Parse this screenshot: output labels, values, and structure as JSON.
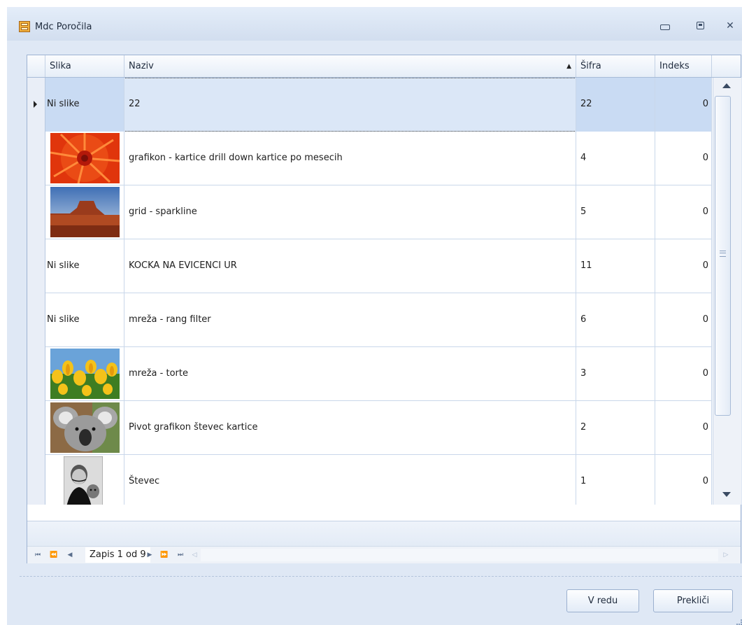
{
  "window": {
    "title": "Mdc Poročila"
  },
  "grid": {
    "columns": {
      "slika": "Slika",
      "naziv": "Naziv",
      "sifra": "Šifra",
      "indeks": "Indeks"
    },
    "rows": [
      {
        "slika": "Ni slike",
        "image": "",
        "naziv": "22",
        "sifra": "22",
        "indeks": "0",
        "selected": true
      },
      {
        "slika": "",
        "image": "red-flower-photo",
        "naziv": "grafikon - kartice drill down kartice po mesecih",
        "sifra": "4",
        "indeks": "0"
      },
      {
        "slika": "",
        "image": "desert-butte-photo",
        "naziv": "grid - sparkline",
        "sifra": "5",
        "indeks": "0"
      },
      {
        "slika": "Ni slike",
        "image": "",
        "naziv": "KOCKA NA EVICENCI UR",
        "sifra": "11",
        "indeks": "0"
      },
      {
        "slika": "Ni slike",
        "image": "",
        "naziv": "mreža - rang filter",
        "sifra": "6",
        "indeks": "0"
      },
      {
        "slika": "",
        "image": "yellow-tulips-photo",
        "naziv": "mreža - torte",
        "sifra": "3",
        "indeks": "0"
      },
      {
        "slika": "",
        "image": "koala-photo",
        "naziv": "Pivot grafikon števec kartice",
        "sifra": "2",
        "indeks": "0"
      },
      {
        "slika": "",
        "image": "man-with-cat-photo",
        "naziv": "Števec",
        "sifra": "1",
        "indeks": "0"
      }
    ]
  },
  "navigator": {
    "record_info": "Zapis 1 od 9"
  },
  "buttons": {
    "ok": "V redu",
    "cancel": "Prekliči"
  },
  "colors": {
    "selection": "#c9dbf3",
    "window_bg": "#dfe8f5",
    "border": "#9db2d2"
  }
}
